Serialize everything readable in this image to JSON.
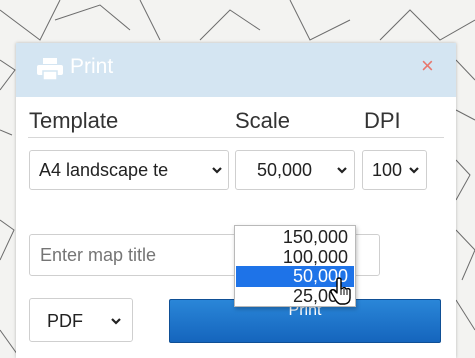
{
  "dialog": {
    "title": "Print",
    "close_symbol": "×",
    "icon": "printer-icon"
  },
  "labels": {
    "template": "Template",
    "scale": "Scale",
    "dpi": "DPI"
  },
  "selects": {
    "template_value": "A4 landscape te",
    "scale_value": "50,000",
    "dpi_value": "100",
    "format_value": "PDF"
  },
  "scale_options": [
    "150,000",
    "100,000",
    "50,000",
    "25,000"
  ],
  "scale_selected_index": 2,
  "map_title": {
    "placeholder": "Enter map title"
  },
  "buttons": {
    "print": "Print"
  },
  "colors": {
    "header_bg": "#d4e5f2",
    "close": "#e8766c",
    "accent": "#1e73e8",
    "button": "#1565bd"
  }
}
